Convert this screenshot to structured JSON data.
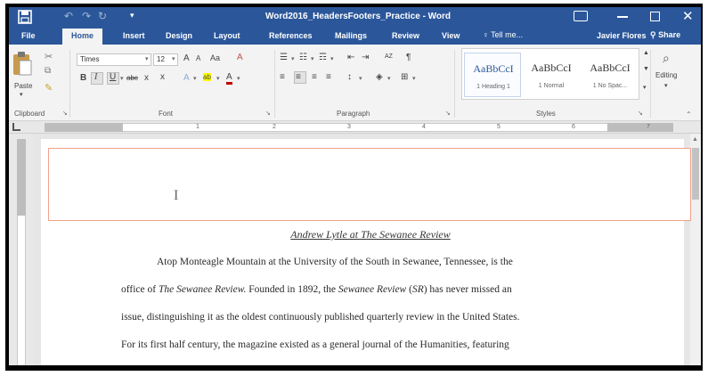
{
  "titlebar": {
    "title": "Word2016_HeadersFooters_Practice - Word",
    "icons": [
      "save-icon",
      "undo-icon",
      "redo-icon",
      "repeat-icon",
      "customize-quick-access-icon",
      "ribbon-display-options-icon",
      "minimize-icon",
      "maximize-icon",
      "close-icon"
    ]
  },
  "tabs": {
    "items": [
      "File",
      "Home",
      "Insert",
      "Design",
      "Layout",
      "References",
      "Mailings",
      "Review",
      "View"
    ],
    "active": "Home",
    "tell_me": "Tell me...",
    "user": "Javier Flores",
    "share": "Share"
  },
  "ribbon": {
    "clipboard": {
      "paste": "Paste",
      "label": "Clipboard"
    },
    "font": {
      "font_name": "Times",
      "font_size": "12",
      "label": "Font",
      "glyphs": {
        "grow": "A",
        "shrink": "A",
        "case": "Aa",
        "clear": "A",
        "bold": "B",
        "italic": "I",
        "underline": "U",
        "strike": "abc",
        "sub": "x",
        "sup": "x",
        "effects": "A",
        "highlight": "ab",
        "color": "A"
      }
    },
    "paragraph": {
      "label": "Paragraph",
      "sort_glyph": "AZ",
      "pilcrow": "¶"
    },
    "styles": {
      "label": "Styles",
      "items": [
        {
          "sample": "AaBbCcI",
          "name": "1 Heading 1"
        },
        {
          "sample": "AaBbCcI",
          "name": "1 Normal"
        },
        {
          "sample": "AaBbCcI",
          "name": "1 No Spac..."
        }
      ]
    },
    "editing": {
      "label": "Editing"
    }
  },
  "ruler": {
    "ticks": [
      "1",
      "2",
      "3",
      "4",
      "5",
      "6",
      "7"
    ]
  },
  "document": {
    "title": "Andrew Lytle at The Sewanee Review",
    "lines": [
      {
        "parts": [
          {
            "t": "Atop Monteagle Mountain at the University of the South in Sewanee, Tennessee, is the",
            "i": false
          }
        ]
      },
      {
        "parts": [
          {
            "t": "office of ",
            "i": false
          },
          {
            "t": "The Sewanee Review.",
            "i": true
          },
          {
            "t": " Founded in 1892, the ",
            "i": false
          },
          {
            "t": "Sewanee Review",
            "i": true
          },
          {
            "t": " (",
            "i": false
          },
          {
            "t": "SR",
            "i": true
          },
          {
            "t": ") has never missed an",
            "i": false
          }
        ]
      },
      {
        "parts": [
          {
            "t": "issue, distinguishing it as the oldest continuously published quarterly review in the United States.",
            "i": false
          }
        ]
      },
      {
        "parts": [
          {
            "t": "For its first half century, the magazine existed as a general journal of the Humanities, featuring",
            "i": false
          }
        ]
      }
    ]
  },
  "colors": {
    "accent": "#2b579a",
    "header_border": "#f2a18a"
  }
}
